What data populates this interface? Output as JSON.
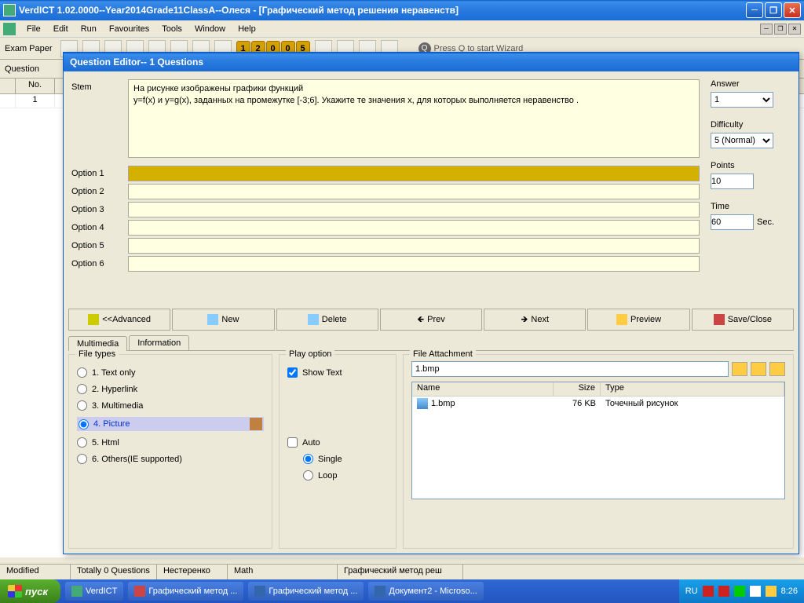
{
  "app": {
    "title": "VerdICT 1.02.0000--Year2014Grade11ClassA--Олеся - [Графический метод решения неравенств]"
  },
  "menu": {
    "file": "File",
    "edit": "Edit",
    "run": "Run",
    "fav": "Favourites",
    "tools": "Tools",
    "window": "Window",
    "help": "Help"
  },
  "toolbar": {
    "exampaper": "Exam Paper",
    "question": "Question",
    "numbers": [
      "1",
      "2",
      "0",
      "0",
      "5"
    ],
    "wizard": "Press Q to start Wizard"
  },
  "grid": {
    "col_no": "No.",
    "row1": "1"
  },
  "dialog": {
    "title": "Question Editor-- 1 Questions",
    "stem_label": "Stem",
    "stem_text1": "На рисунке изображены графики функций",
    "stem_text2": " y=f(x) и  y=g(x), заданных на промежутке  [-3;6]. Укажите те значения  x,  для которых выполняется неравенство   .",
    "opt1": "Option 1",
    "opt2": "Option 2",
    "opt3": "Option 3",
    "opt4": "Option 4",
    "opt5": "Option 5",
    "opt6": "Option 6",
    "answer_label": "Answer",
    "answer_value": "1",
    "difficulty_label": "Difficulty",
    "difficulty_value": "5 (Normal)",
    "points_label": "Points",
    "points_value": "10",
    "time_label": "Time",
    "time_value": "60",
    "time_unit": "Sec.",
    "btn_advanced": "<<Advanced",
    "btn_new": "New",
    "btn_delete": "Delete",
    "btn_prev": "Prev",
    "btn_next": "Next",
    "btn_preview": "Preview",
    "btn_save": "Save/Close",
    "tab_multimedia": "Multimedia",
    "tab_information": "Information",
    "filetypes_legend": "File types",
    "ft1": "1. Text only",
    "ft2": "2. Hyperlink",
    "ft3": "3. Multimedia",
    "ft4": "4. Picture",
    "ft5": "5. Html",
    "ft6": "6. Others(IE supported)",
    "playopt_legend": "Play option",
    "show_text": "Show Text",
    "auto": "Auto",
    "single": "Single",
    "loop": "Loop",
    "fileattach_legend": "File Attachment",
    "fa_value": "1.bmp",
    "fa_col_name": "Name",
    "fa_col_size": "Size",
    "fa_col_type": "Type",
    "fa_row_name": "1.bmp",
    "fa_row_size": "76 KB",
    "fa_row_type": "Точечный рисунок"
  },
  "status": {
    "modified": "Modified",
    "totally": "Totally 0 Questions",
    "author": "Нестеренко",
    "subject": "Math",
    "topic": "Графический метод реш"
  },
  "taskbar": {
    "start": "пуск",
    "t1": "VerdICT",
    "t2": "Графический метод ...",
    "t3": "Графический метод ...",
    "t4": "Документ2 - Microso...",
    "lang": "RU",
    "clock": "8:26"
  }
}
